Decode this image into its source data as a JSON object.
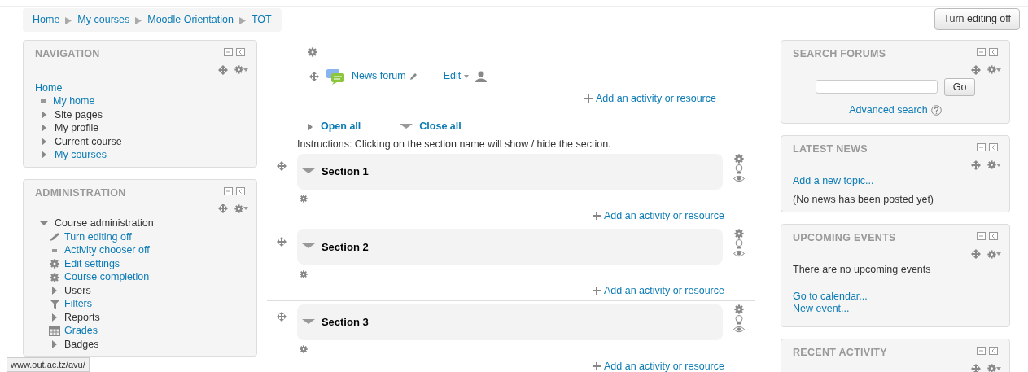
{
  "breadcrumb": [
    {
      "label": "Home"
    },
    {
      "label": "My courses"
    },
    {
      "label": "Moodle Orientation"
    },
    {
      "label": "TOT"
    }
  ],
  "edit_button": "Turn editing off",
  "navigation": {
    "title": "NAVIGATION",
    "root": "Home",
    "items": [
      {
        "label": "My home",
        "kind": "bullet",
        "link": true
      },
      {
        "label": "Site pages",
        "kind": "branch",
        "link": false
      },
      {
        "label": "My profile",
        "kind": "branch",
        "link": false
      },
      {
        "label": "Current course",
        "kind": "branch",
        "link": false
      },
      {
        "label": "My courses",
        "kind": "branch",
        "link": true
      }
    ]
  },
  "administration": {
    "title": "ADMINISTRATION",
    "root": {
      "label": "Course administration",
      "expanded": true
    },
    "items": [
      {
        "label": "Turn editing off",
        "kind": "pencil",
        "link": true
      },
      {
        "label": "Activity chooser off",
        "kind": "bullet",
        "link": true
      },
      {
        "label": "Edit settings",
        "kind": "gear",
        "link": true
      },
      {
        "label": "Course completion",
        "kind": "gear",
        "link": true
      },
      {
        "label": "Users",
        "kind": "branch",
        "link": false
      },
      {
        "label": "Filters",
        "kind": "filter",
        "link": true
      },
      {
        "label": "Reports",
        "kind": "branch",
        "link": false
      },
      {
        "label": "Grades",
        "kind": "table",
        "link": true
      },
      {
        "label": "Badges",
        "kind": "branch",
        "link": false
      }
    ]
  },
  "course": {
    "forum": "News forum",
    "edit": "Edit",
    "add_activity": "Add an activity or resource",
    "open_all": "Open all",
    "close_all": "Close all",
    "instructions": "Instructions: Clicking on the section name will show / hide the section.",
    "sections": [
      {
        "title": "Section 1",
        "add_activity": "Add an activity or resource"
      },
      {
        "title": "Section 2",
        "add_activity": "Add an activity or resource"
      },
      {
        "title": "Section 3",
        "add_activity": "Add an activity or resource"
      }
    ]
  },
  "search_forums": {
    "title": "SEARCH FORUMS",
    "button": "Go",
    "advanced": "Advanced search"
  },
  "latest_news": {
    "title": "LATEST NEWS",
    "link": "Add a new topic...",
    "text": "(No news has been posted yet)"
  },
  "upcoming_events": {
    "title": "UPCOMING EVENTS",
    "text": "There are no upcoming events",
    "links": [
      "Go to calendar...",
      "New event..."
    ]
  },
  "recent_activity": {
    "title": "RECENT ACTIVITY"
  },
  "status_bar": "www.out.ac.tz/avu/"
}
